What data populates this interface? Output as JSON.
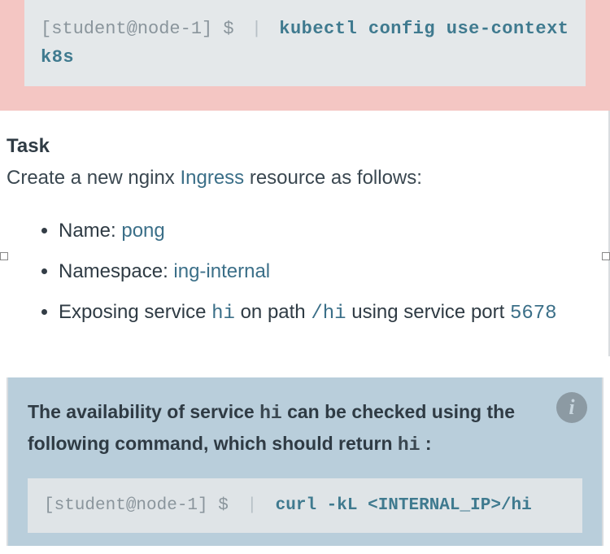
{
  "topCode": {
    "prompt": "[student@node-1] $",
    "command": "kubectl config use-context k8s"
  },
  "task": {
    "heading": "Task",
    "intro_pre": "Create a new nginx ",
    "intro_link": "Ingress",
    "intro_post": " resource as follows:",
    "bullets": {
      "name_label": "Name: ",
      "name_value": "pong",
      "ns_label": "Namespace: ",
      "ns_value": "ing-internal",
      "expose_pre": "Exposing service ",
      "expose_svc": "hi",
      "expose_mid": " on path ",
      "expose_path": "/hi",
      "expose_mid2": " using service port ",
      "expose_port": "5678"
    }
  },
  "info": {
    "text_pre": "The availability of service ",
    "text_svc": "hi",
    "text_mid": " can be checked using the following command, which should return ",
    "text_ret": "hi",
    "text_post": " :",
    "code_prompt": "[student@node-1] $",
    "code_cmd": "curl -kL <INTERNAL_IP>/hi"
  }
}
